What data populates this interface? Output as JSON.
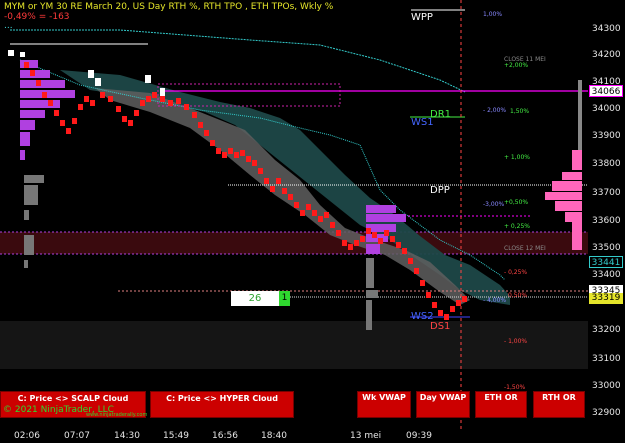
{
  "header": {
    "title": "MYM or YM 30 RE March 20, US Day RTH %, RTH TPO , ETH TPOs, Wkly %",
    "change": "-0,49% = -163",
    "indicator": "..."
  },
  "price_axis": {
    "ticks": [
      "34300",
      "34200",
      "34100",
      "34000",
      "33900",
      "33800",
      "33700",
      "33600",
      "33500",
      "33400",
      "33300",
      "33200",
      "33100",
      "33000",
      "32900"
    ],
    "current_price": "34066",
    "tag_cyan": "33441",
    "tag_white": "33345",
    "tag_yellow": "33319"
  },
  "time_axis": {
    "labels": [
      "02:06",
      "07:07",
      "14:30",
      "15:49",
      "16:56",
      "18:40",
      "13 mei",
      "09:39"
    ]
  },
  "levels": {
    "wpp": "WPP",
    "dr1": "DR1",
    "ws1": "WS1",
    "dpp": "DPP",
    "ws2": "WS2",
    "ds1": "DS1"
  },
  "percent_labels": {
    "p100_top": "1,00%",
    "p200_neg": "- 2,00%",
    "close11": "CLOSE 11 MEI",
    "p200": "+2,00%",
    "p150": "1,50%",
    "p100": "+ 1,00%",
    "p050": "+0,50%",
    "m300": "-3,00%",
    "p025": "+ 0,25%",
    "close12": "CLOSE 12 MEI",
    "m025": "- 0,25%",
    "p050b": "0,50%",
    "m400": "- 4,00%",
    "m100": "- 1,00%",
    "m150": "-1,50%"
  },
  "counter": {
    "value": "26",
    "badge": "1"
  },
  "buttons": {
    "scalp": "C: Price <> SCALP Cloud",
    "hyper": "C: Price <> HYPER Cloud",
    "wk_vwap": "Wk VWAP",
    "day_vwap": "Day VWAP",
    "eth_or": "ETH OR",
    "rth_or": "RTH OR"
  },
  "footer": {
    "copyright": "© 2021 NinjaTrader, LLC",
    "site": "www.ninjatraderally.com"
  },
  "colors": {
    "background": "#000000",
    "profile_purple": "#a844d8",
    "profile_pink": "#ff66bb",
    "bar_red": "#ff1a1a",
    "cloud_teal": "#1f4c4c",
    "cloud_gray": "#6a6a6a",
    "cyan_line": "#33cccc",
    "magenta": "#ff00ff"
  }
}
